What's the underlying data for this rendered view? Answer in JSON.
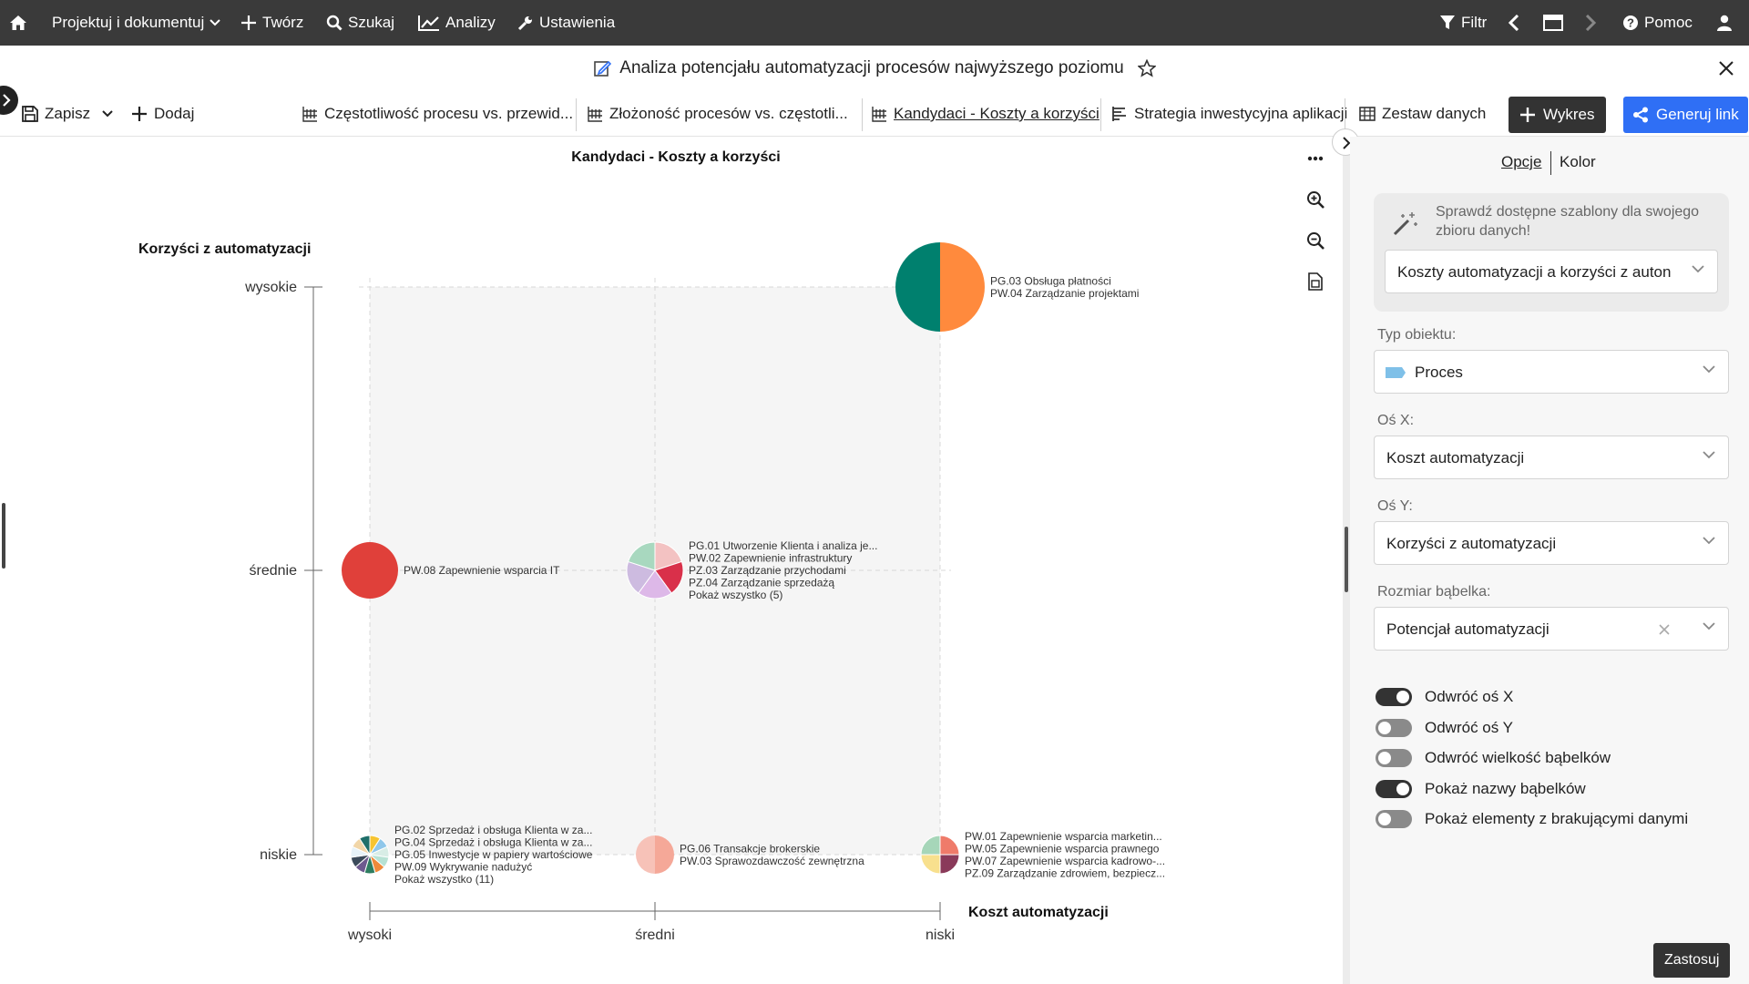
{
  "topnav": {
    "home_icon": "home-icon",
    "projects_label": "Projektuj i dokumentuj",
    "create_label": "Twórz",
    "search_label": "Szukaj",
    "analytics_label": "Analizy",
    "settings_label": "Ustawienia",
    "filter_label": "Filtr",
    "help_label": "Pomoc"
  },
  "titlebar": {
    "title": "Analiza potencjału automatyzacji procesów najwyższego poziomu"
  },
  "toolbar": {
    "save_label": "Zapisz",
    "add_label": "Dodaj",
    "tabs": [
      {
        "label": "Częstotliwość procesu vs. przewid..."
      },
      {
        "label": "Złożoność procesów vs. częstotli..."
      },
      {
        "label": "Kandydaci - Koszty a korzyści"
      },
      {
        "label": "Strategia inwestycyjna aplikacji"
      },
      {
        "label": "Zestaw danych"
      }
    ],
    "chart_button_label": "Wykres",
    "generate_link_label": "Generuj link"
  },
  "chart": {
    "title": "Kandydaci - Koszty a korzyści",
    "more_icon": "ellipsis-icon"
  },
  "chart_data": {
    "type": "scatter",
    "title": "Kandydaci - Koszty a korzyści",
    "xlabel": "Koszt automatyzacji",
    "ylabel": "Korzyści z automatyzacji",
    "x_categories": [
      "wysoki",
      "średni",
      "niski"
    ],
    "y_categories": [
      "niskie",
      "średnie",
      "wysokie"
    ],
    "bubbles": [
      {
        "x": "niski",
        "y": "wysokie",
        "size": "large",
        "labels": [
          "PG.03 Obsługa płatności",
          "PW.04 Zarządzanie projektami"
        ],
        "colors": [
          "#ff8a3d",
          "#00806e"
        ]
      },
      {
        "x": "wysoki",
        "y": "średnie",
        "size": "medium",
        "labels": [
          "PW.08 Zapewnienie wsparcia IT"
        ],
        "colors": [
          "#e0403a"
        ]
      },
      {
        "x": "średni",
        "y": "średnie",
        "size": "medium",
        "labels": [
          "PG.01 Utworzenie Klienta i analiza je...",
          "PW.02 Zapewnienie infrastruktury",
          "PZ.03 Zarządzanie przychodami",
          "PZ.04 Zarządzanie sprzedażą",
          "Pokaż wszystko (5)"
        ],
        "colors": [
          "#f3c2c2",
          "#d9304a",
          "#ddb8e8",
          "#cdbbe0",
          "#a8d8bf"
        ]
      },
      {
        "x": "wysoki",
        "y": "niskie",
        "size": "small",
        "labels": [
          "PG.02 Sprzedaż i obsługa Klienta w za...",
          "PG.04 Sprzedaż i obsługa Klienta w za...",
          "PG.05 Inwestycje w papiery wartościowe",
          "PW.09 Wykrywanie nadużyć",
          "Pokaż wszystko (11)"
        ],
        "colors": [
          "#f6c431",
          "#8fc7ea",
          "#d8ede6",
          "#b7e2d4",
          "#f08a3a",
          "#2e7d60",
          "#6e5a8f",
          "#3b4a5a",
          "#e6f2f8",
          "#f1d6a8",
          "#1f6f6a"
        ]
      },
      {
        "x": "średni",
        "y": "niskie",
        "size": "small",
        "labels": [
          "PG.06 Transakcje brokerskie",
          "PW.03 Sprawozdawczość zewnętrzna"
        ],
        "colors": [
          "#f5a898",
          "#f7c2b8"
        ]
      },
      {
        "x": "niski",
        "y": "niskie",
        "size": "small",
        "labels": [
          "PW.01 Zapewnienie wsparcia marketin...",
          "PW.05 Zapewnienie wsparcia prawnego",
          "PW.07 Zapewnienie wsparcia kadrowo-...",
          "PZ.09 Zarządzanie zdrowiem, bezpiecz..."
        ],
        "colors": [
          "#ef7b6a",
          "#8a3a5a",
          "#f8e08e",
          "#a6d6b9"
        ]
      }
    ]
  },
  "panel": {
    "tab_options": "Opcje",
    "tab_color": "Kolor",
    "template_hint": "Sprawdź dostępne szablony dla swojego zbioru danych!",
    "template_value": "Koszty automatyzacji a korzyści z auton",
    "object_type_label": "Typ obiektu:",
    "object_type_value": "Proces",
    "x_axis_label": "Oś X:",
    "x_axis_value": "Koszt automatyzacji",
    "y_axis_label": "Oś Y:",
    "y_axis_value": "Korzyści z automatyzacji",
    "bubble_size_label": "Rozmiar bąbelka:",
    "bubble_size_value": "Potencjał automatyzacji",
    "toggles": [
      {
        "label": "Odwróć oś X",
        "on": true
      },
      {
        "label": "Odwróć oś Y",
        "on": false
      },
      {
        "label": "Odwróć wielkość bąbelków",
        "on": false
      },
      {
        "label": "Pokaż nazwy bąbelków",
        "on": true
      },
      {
        "label": "Pokaż elementy z brakującymi danymi",
        "on": false
      }
    ],
    "apply_label": "Zastosuj"
  }
}
